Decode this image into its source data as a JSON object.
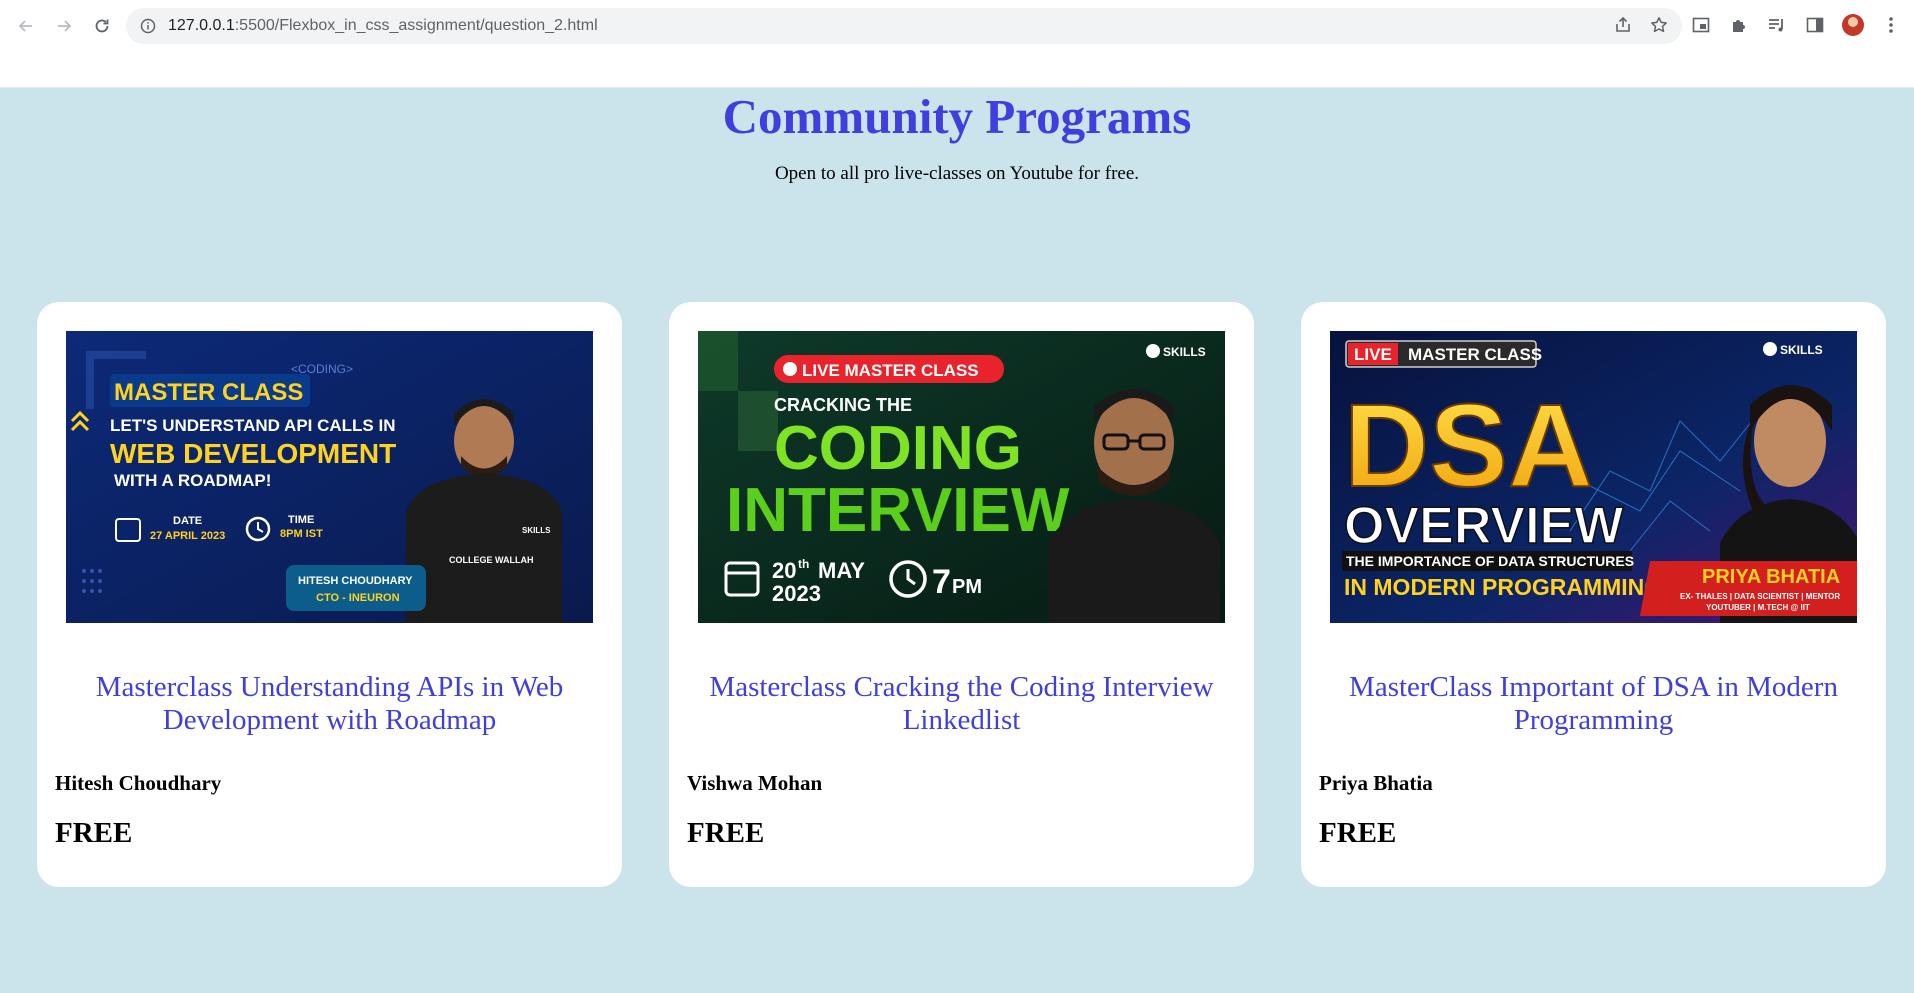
{
  "browser": {
    "url_host": "127.0.0.1",
    "url_path": ":5500/Flexbox_in_css_assignment/question_2.html"
  },
  "page": {
    "title": "Community Programs",
    "subtitle": "Open to all pro live-classes on Youtube for free."
  },
  "cards": [
    {
      "title": "Masterclass Understanding APIs in Web Development with Roadmap",
      "instructor": "Hitesh Choudhary",
      "price": "FREE",
      "thumb": {
        "badge": "MASTER CLASS",
        "line1": "LET'S UNDERSTAND API CALLS IN",
        "line2": "WEB DEVELOPMENT",
        "line3": "WITH A ROADMAP!",
        "date_label": "DATE",
        "date": "27 APRIL 2023",
        "time_label": "TIME",
        "time": "8PM IST",
        "name": "HITESH CHOUDHARY",
        "role": "CTO - INEURON",
        "code_tag": "<CODING>",
        "brand": "SKILLS",
        "shirt": "COLLEGE WALLAH"
      }
    },
    {
      "title": "Masterclass Cracking the Coding Interview Linkedlist",
      "instructor": "Vishwa Mohan",
      "price": "FREE",
      "thumb": {
        "badge": "LIVE MASTER CLASS",
        "line1": "CRACKING THE",
        "line2": "CODING",
        "line3": "INTERVIEW",
        "date_day": "20",
        "date_sup": "th",
        "date_month": "MAY",
        "date_year": "2023",
        "time": "7",
        "time_suffix": "PM",
        "brand": "SKILLS"
      }
    },
    {
      "title": "MasterClass Important of DSA in Modern Programming",
      "instructor": "Priya Bhatia",
      "price": "FREE",
      "thumb": {
        "live": "LIVE",
        "badge": "MASTER CLASS",
        "line1": "DSA",
        "line2": "OVERVIEW",
        "line3": "THE IMPORTANCE OF DATA STRUCTURES",
        "line4": "IN MODERN PROGRAMMING",
        "name": "PRIYA BHATIA",
        "role1": "EX- THALES | DATA SCIENTIST | MENTOR",
        "role2": "YOUTUBER | M.TECH @ IIT",
        "brand": "SKILLS"
      }
    }
  ]
}
